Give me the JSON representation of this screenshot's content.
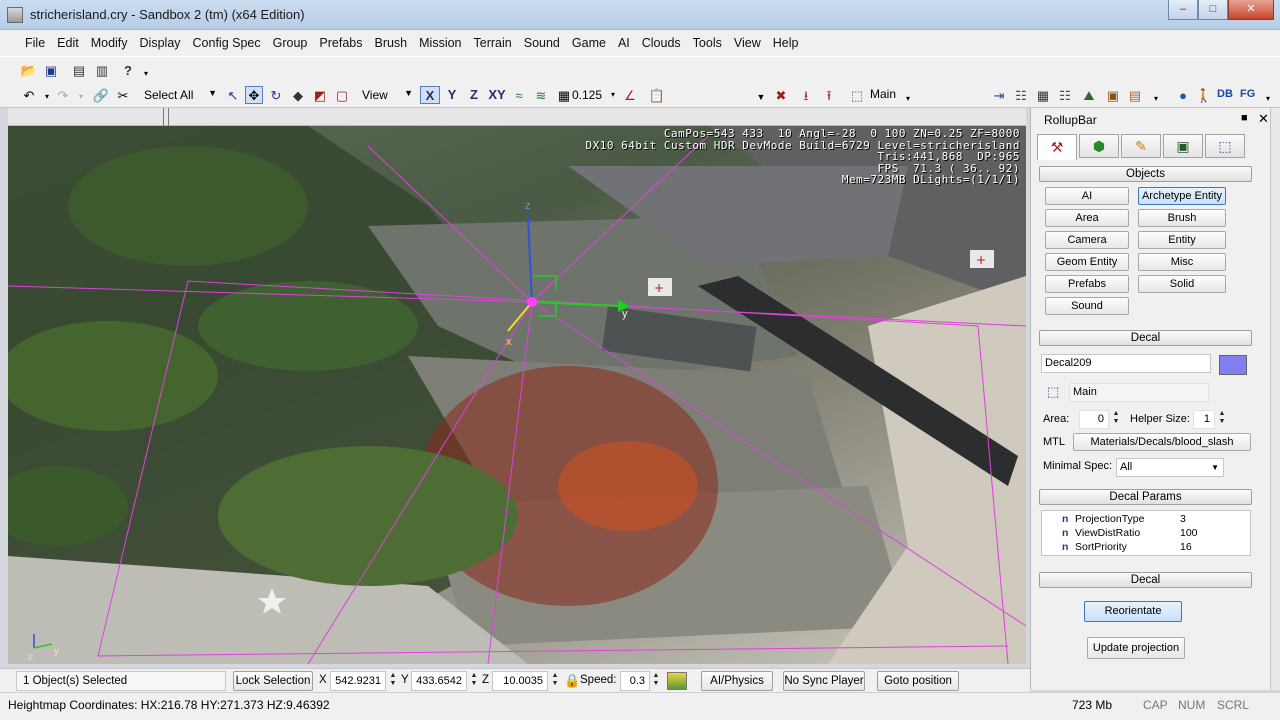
{
  "window": {
    "title": "stricherisland.cry - Sandbox 2 (tm) (x64 Edition)",
    "min": "–",
    "max": "□",
    "close": "✕"
  },
  "menu": [
    "File",
    "Edit",
    "Modify",
    "Display",
    "Config Spec",
    "Group",
    "Prefabs",
    "Brush",
    "Mission",
    "Terrain",
    "Sound",
    "Game",
    "AI",
    "Clouds",
    "Tools",
    "View",
    "Help"
  ],
  "toolbar": {
    "select_all": "Select All",
    "ref_coord": "View",
    "axes": [
      "X",
      "Y",
      "Z",
      "XY"
    ],
    "grid_size": "0.125",
    "layer": "Main",
    "right_labels": [
      "DB",
      "FG"
    ]
  },
  "viewport": {
    "hud_lines": [
      "CamPos=543 433  10 Angl=-28  0 100 ZN=0.25 ZF=8000",
      "DX10 64bit Custom HDR DevMode Build=6729 Level=stricherisland",
      "Tris:441,868  DP:965",
      "FPS  71.3 ( 36.. 92)",
      "Mem=723MB DLights=(1/1/1)"
    ],
    "gizmo_labels": {
      "x": "x",
      "y": "y",
      "z": "z"
    },
    "corner_axes": {
      "y": "y",
      "z": "z"
    }
  },
  "rollup": {
    "title": "RollupBar",
    "pin": "■",
    "close": "✕",
    "objects_header": "Objects",
    "object_buttons": [
      "AI",
      "Archetype Entity",
      "Area",
      "Brush",
      "Camera",
      "Entity",
      "Geom Entity",
      "Misc",
      "Prefabs",
      "Solid",
      "Sound"
    ],
    "decal_header": "Decal",
    "decal_name": "Decal209",
    "decal_color": "#8080f0",
    "layer": "Main",
    "area_label": "Area:",
    "area_value": "0",
    "helper_label": "Helper Size:",
    "helper_value": "1",
    "mtl_label": "MTL",
    "mtl_value": "Materials/Decals/blood_slash",
    "minspec_label": "Minimal Spec:",
    "minspec_value": "All",
    "params_header": "Decal Params",
    "params": [
      {
        "flag": "n",
        "key": "ProjectionType",
        "value": "3"
      },
      {
        "flag": "n",
        "key": "ViewDistRatio",
        "value": "100"
      },
      {
        "flag": "n",
        "key": "SortPriority",
        "value": "16"
      }
    ],
    "decal_header2": "Decal",
    "reorient": "Reorientate",
    "update_projection": "Update projection"
  },
  "status": {
    "selection": "1 Object(s) Selected",
    "lock_selection": "Lock Selection",
    "x_label": "X",
    "x_value": "542.9231",
    "y_label": "Y",
    "y_value": "433.6542",
    "z_label": "Z",
    "z_value": "10.0035",
    "speed_label": "Speed:",
    "speed_value": "0.3",
    "ai_physics": "AI/Physics",
    "no_sync": "No Sync Player",
    "goto": "Goto position",
    "heightmap": "Heightmap Coordinates: HX:216.78 HY:271.373 HZ:9.46392",
    "memory": "723 Mb",
    "cap": "CAP",
    "num": "NUM",
    "scrl": "SCRL"
  }
}
